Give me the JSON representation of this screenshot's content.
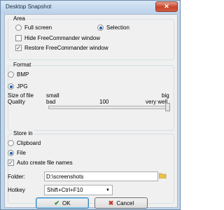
{
  "window": {
    "title": "Desktop Snapshot",
    "close_glyph": "✕"
  },
  "area": {
    "label": "Area",
    "full_screen": "Full screen",
    "selection": "Selection",
    "selected": "selection",
    "hide_window": {
      "label": "Hide FreeCommander window",
      "checked": false
    },
    "restore_window": {
      "label": "Restore FreeCommander window",
      "checked": true
    }
  },
  "format": {
    "label": "Format",
    "bmp": "BMP",
    "jpg": "JPG",
    "selected": "jpg",
    "size_label": "Size of file",
    "size_min": "small",
    "size_max": "big",
    "quality_label": "Quality",
    "quality_min": "bad",
    "quality_value": "100",
    "quality_max": "very well"
  },
  "store": {
    "label": "Store in",
    "clipboard": "Clipboard",
    "file": "File",
    "selected": "file",
    "auto_names": {
      "label": "Auto create file names",
      "checked": true
    },
    "folder_label": "Folder:",
    "folder_value": "D:\\screenshots",
    "hotkey_label": "Hotkey",
    "hotkey_value": "Shift+Ctrl+F10"
  },
  "buttons": {
    "ok": "OK",
    "cancel": "Cancel"
  },
  "icons": {
    "close": "close-icon",
    "folder": "folder-icon",
    "ok": "checkmark-icon",
    "cancel": "x-icon",
    "dropdown": "chevron-down-icon"
  },
  "colors": {
    "ok_icon": "#2e8b2e",
    "cancel_icon": "#c0392b",
    "radio_dot": "#1f5fa8",
    "folder": "#e8c34a"
  }
}
